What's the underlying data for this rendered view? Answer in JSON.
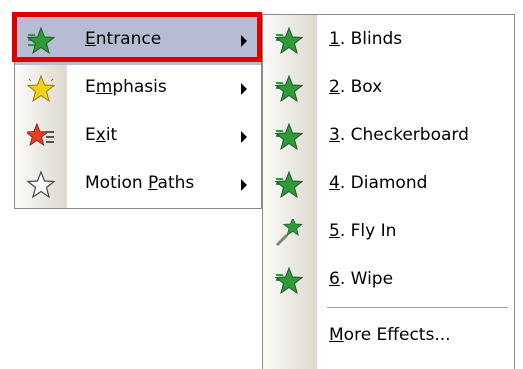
{
  "main_menu": {
    "items": [
      {
        "label": "Entrance",
        "accel": "E",
        "icon": "entrance-star-icon",
        "has_submenu": true,
        "highlighted": true
      },
      {
        "label": "Emphasis",
        "accel": "m",
        "icon": "emphasis-star-icon",
        "has_submenu": true,
        "highlighted": false
      },
      {
        "label": "Exit",
        "accel": "x",
        "icon": "exit-star-icon",
        "has_submenu": true,
        "highlighted": false
      },
      {
        "label": "Motion Paths",
        "accel": "P",
        "icon": "motion-path-star-icon",
        "has_submenu": true,
        "highlighted": false
      }
    ]
  },
  "submenu": {
    "items": [
      {
        "label": "1. Blinds",
        "accel": "1",
        "icon": "green-star-icon"
      },
      {
        "label": "2. Box",
        "accel": "2",
        "icon": "green-star-icon"
      },
      {
        "label": "3. Checkerboard",
        "accel": "3",
        "icon": "green-star-icon"
      },
      {
        "label": "4. Diamond",
        "accel": "4",
        "icon": "green-star-icon"
      },
      {
        "label": "5. Fly In",
        "accel": "5",
        "icon": "fly-in-star-icon"
      },
      {
        "label": "6. Wipe",
        "accel": "6",
        "icon": "green-star-icon"
      }
    ],
    "more": {
      "label": "More Effects...",
      "accel": "M"
    }
  },
  "colors": {
    "highlight": "#b6bdd2",
    "frame": "#e00000",
    "green_star": "#2e9a3a",
    "yellow_star": "#f2cf1a",
    "red_star": "#e0402a"
  }
}
